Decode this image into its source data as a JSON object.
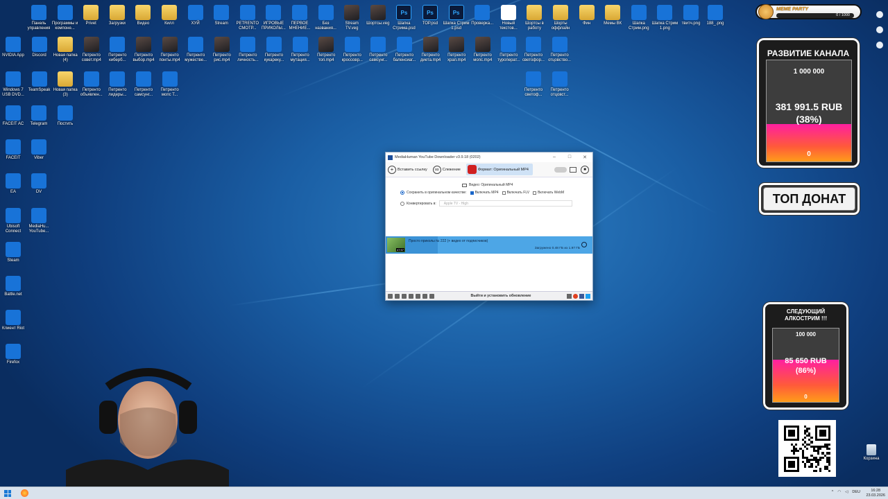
{
  "desktop": {
    "row1": [
      "Панель управления",
      "Программы и компоне...",
      "Privet",
      "Загрузки",
      "Видео",
      "Килл",
      "ХУЙ",
      "Stream",
      "PETRENTO СМОТР...",
      "ИГРОВЫЕ ПРИКОЛЫ...",
      "ПЕРВОЕ МНЕНИЕ...",
      "Без названия...",
      "Stream TV.veg",
      "Шортсы.veg",
      "Шапка Стрима.psd",
      "ТОР.psd",
      "Шапка Стрим 1.psd",
      "Проверка...",
      "Новый текстов...",
      "Шортсы в работу",
      "Шорты оффлайн",
      "Фин",
      "Мемы ВК",
      "Шапка Стрим.png",
      "Шапка Стрим 1.png",
      "твитч.png",
      "188_.png"
    ],
    "row2": [
      "NVIDIA App",
      "Discord",
      "Новая папка (4)",
      "Петренто совет.mp4",
      "Петренто киберб...",
      "Петренто выбор.mp4",
      "Петренто понты.mp4",
      "Петренто мужестве...",
      "Петренто рис.mp4",
      "Петренто личность...",
      "Петренто кукареку...",
      "Петренто мутация...",
      "Петренто топ.mp4",
      "Петренто кроссовр...",
      "Петренто самсунг...",
      "Петренто баленсиаг...",
      "Петренто диета.mp4",
      "Петренто храп.mp4",
      "Петренто мопс.mp4",
      "Петренто туроперат...",
      "Петренто светофор...",
      "Петренто отцовство..."
    ],
    "row3": [
      "Windows 7 USB DVD...",
      "TeamSpeak",
      "Новая папка (3)",
      "Петренто объявлен...",
      "Петренто лидеры...",
      "Петренто самсунг...",
      "Петренто мопс Т...",
      "Петренто светоф...",
      "Петренто отцовст..."
    ],
    "col1": [
      "FACEIT AC",
      "Telegram",
      "Постить",
      "FACEIT",
      "Viber",
      "EA",
      "DV",
      "Ubisoft Connect",
      "MediaHu... YouTube...",
      "Steam",
      "Battle.net",
      "Клиент Riot",
      "Firefox"
    ],
    "recycle_bin": "Корзина"
  },
  "downloader": {
    "title": "MediaHuman YouTube Downloader v3.9.18 (0202)",
    "toolbar": {
      "paste_link": "Вставить ссылку",
      "tracking": "Слежение",
      "format": "Формат: Оригинальный MP4"
    },
    "options": {
      "header": "Видео: Оригинальный MP4",
      "save_original": "Сохранить в оригинальном качестве:",
      "include_mp4": "Включать MP4",
      "include_flv": "Включать FLV",
      "include_webm": "Включать WebM",
      "convert_to": "Конвертировать в:",
      "convert_preset": "Apple TV - High"
    },
    "item": {
      "title": "Просто приколы № 222 (+ видео от подписчиков)",
      "duration": "47:57",
      "status": "Загружено 0.48 ГБ из 1.97 ГБ",
      "progress": 0.25
    },
    "statusbar": {
      "update_text": "Выйти и установить обновление"
    }
  },
  "overlay": {
    "meme_party": {
      "title": "MEME PARTY",
      "counter": "0 / 1000"
    },
    "channel_goal": {
      "title": "РАЗВИТИЕ КАНАЛА",
      "target": "1 000 000",
      "current": "381 991.5 RUB",
      "percent": "(38%)",
      "start": "0",
      "fraction": 0.38
    },
    "top_donate": "ТОП ДОНАТ",
    "next_goal": {
      "title": "СЛЕДУЮЩИЙ АЛКОСТРИМ !!!",
      "target": "100 000",
      "current": "85 650 RUB",
      "percent": "(86%)",
      "start": "0",
      "fraction": 0.86
    }
  },
  "taskbar": {
    "lang": "DEU",
    "time": "16:28",
    "date": "23.03.2026"
  },
  "colors": {
    "desktop_blue": "#1a5ea4",
    "goal_fill_top": "#ff1fa0",
    "goal_fill_bottom": "#ff9c1a",
    "progress_blue": "#4da6e6"
  }
}
